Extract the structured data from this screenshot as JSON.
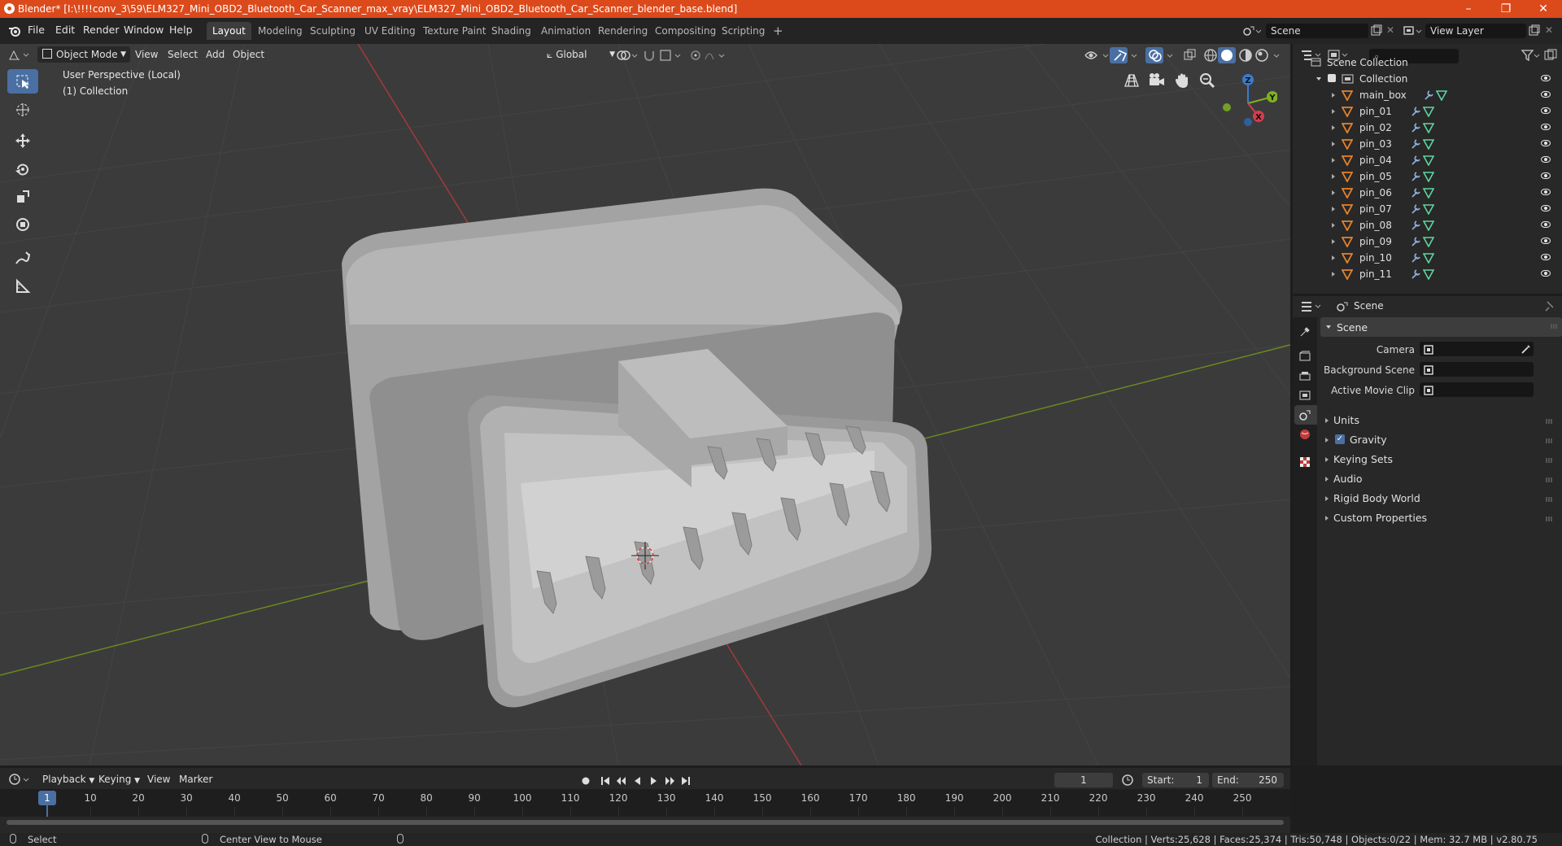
{
  "window": {
    "title": "Blender* [I:\\!!!!conv_3\\59\\ELM327_Mini_OBD2_Bluetooth_Car_Scanner_max_vray\\ELM327_Mini_OBD2_Bluetooth_Car_Scanner_blender_base.blend]",
    "controls": {
      "minimize": "–",
      "restore": "❐",
      "close": "✕"
    }
  },
  "menubar": {
    "menus": [
      "File",
      "Edit",
      "Render",
      "Window",
      "Help"
    ],
    "workspaces": [
      "Layout",
      "Modeling",
      "Sculpting",
      "UV Editing",
      "Texture Paint",
      "Shading",
      "Animation",
      "Rendering",
      "Compositing",
      "Scripting"
    ],
    "active_workspace": "Layout",
    "add_tab": "+",
    "scene_name": "Scene",
    "view_layer": "View Layer"
  },
  "viewport": {
    "mode": "Object Mode",
    "menus": [
      "View",
      "Select",
      "Add",
      "Object"
    ],
    "orientation": "Global",
    "overlay_line1": "User Perspective (Local)",
    "overlay_line2": "(1) Collection",
    "axis_labels": {
      "x": "X",
      "y": "Y",
      "z": "Z"
    },
    "colors": {
      "background": "#3b3b3b",
      "x_axis": "#a33a3a",
      "y_axis": "#6c8a1e",
      "model": "#9d9d9d",
      "active_tool": "#4a6fa3"
    }
  },
  "outliner": {
    "search_placeholder": "",
    "root": "Scene Collection",
    "collection": "Collection",
    "objects": [
      "main_box",
      "pin_01",
      "pin_02",
      "pin_03",
      "pin_04",
      "pin_05",
      "pin_06",
      "pin_07",
      "pin_08",
      "pin_09",
      "pin_10",
      "pin_11"
    ]
  },
  "properties": {
    "header_title": "Scene",
    "panel_title": "Scene",
    "fields": [
      {
        "label": "Camera",
        "value": ""
      },
      {
        "label": "Background Scene",
        "value": ""
      },
      {
        "label": "Active Movie Clip",
        "value": ""
      }
    ],
    "sections": [
      {
        "label": "Units",
        "checkbox": false
      },
      {
        "label": "Gravity",
        "checkbox": true
      },
      {
        "label": "Keying Sets",
        "checkbox": false
      },
      {
        "label": "Audio",
        "checkbox": false
      },
      {
        "label": "Rigid Body World",
        "checkbox": false
      },
      {
        "label": "Custom Properties",
        "checkbox": false
      }
    ]
  },
  "timeline": {
    "menus": [
      "Playback",
      "Keying",
      "View",
      "Marker"
    ],
    "current_frame": "1",
    "start_label": "Start:",
    "start": "1",
    "end_label": "End:",
    "end": "250",
    "frame_ticks": [
      "10",
      "20",
      "30",
      "40",
      "50",
      "60",
      "70",
      "80",
      "90",
      "100",
      "110",
      "120",
      "130",
      "140",
      "150",
      "160",
      "170",
      "180",
      "190",
      "200",
      "210",
      "220",
      "230",
      "240",
      "250"
    ],
    "playhead": "1"
  },
  "statusbar": {
    "left_action": "Select",
    "mid_action": "Center View to Mouse",
    "stats": "Collection | Verts:25,628 | Faces:25,374 | Tris:50,748 | Objects:0/22 | Mem: 32.7 MB | v2.80.75"
  }
}
